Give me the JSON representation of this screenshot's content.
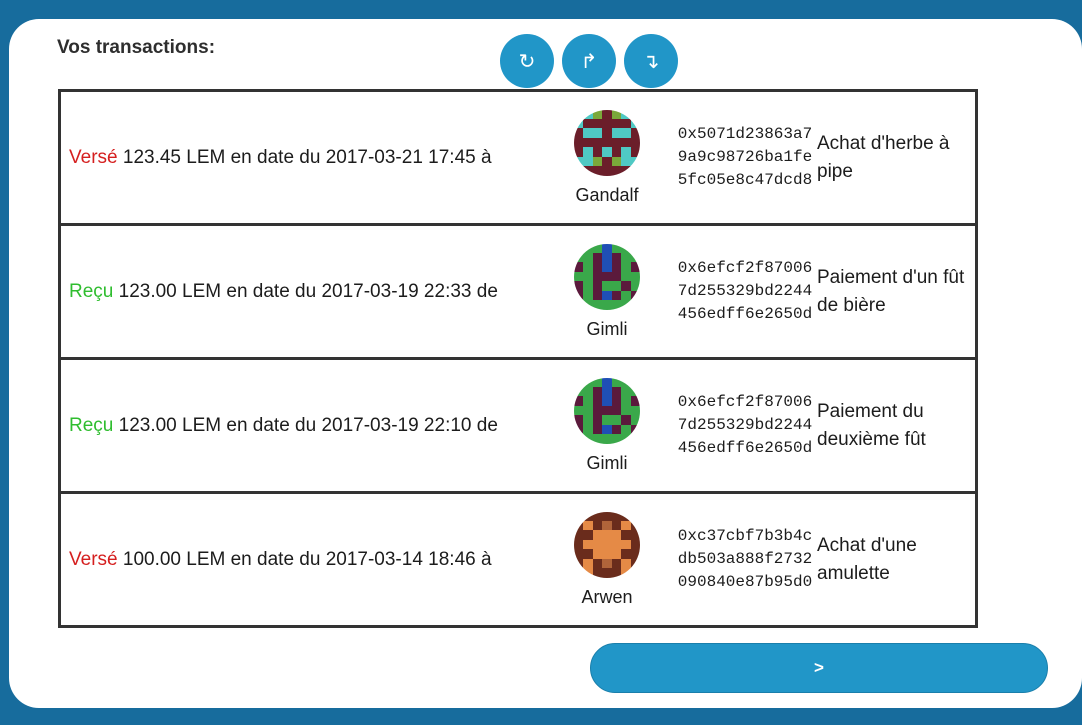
{
  "header": {
    "title": "Vos transactions:"
  },
  "toolbar": {
    "refresh_icon": "↻",
    "up_icon": "↱",
    "down_icon": "↴"
  },
  "transactions": [
    {
      "verb": "Versé",
      "text": "123.45 LEM en date du 2017-03-21 17:45 à",
      "user": "Gandalf",
      "hash": "0x5071d23863a79a9c98726ba1fe5fc05e8c47dcd8",
      "memo": "Achat d'herbe à pipe"
    },
    {
      "verb": "Reçu",
      "text": "123.00 LEM en date du 2017-03-19 22:33 de",
      "user": "Gimli",
      "hash": "0x6efcf2f870067d255329bd2244456edff6e2650d",
      "memo": "Paiement d'un fût de bière"
    },
    {
      "verb": "Reçu",
      "text": "123.00 LEM en date du 2017-03-19 22:10 de",
      "user": "Gimli",
      "hash": "0x6efcf2f870067d255329bd2244456edff6e2650d",
      "memo": "Paiement du deuxième fût"
    },
    {
      "verb": "Versé",
      "text": "100.00 LEM en date du 2017-03-14 18:46 à",
      "user": "Arwen",
      "hash": "0xc37cbf7b3b4cdb503a888f2732090840e87b95d0",
      "memo": "Achat d'une amulette"
    }
  ],
  "footer": {
    "next_label": ">"
  },
  "colors": {
    "sent": "#d51f1f",
    "received": "#2fbd2f",
    "accent": "#2196c8"
  }
}
